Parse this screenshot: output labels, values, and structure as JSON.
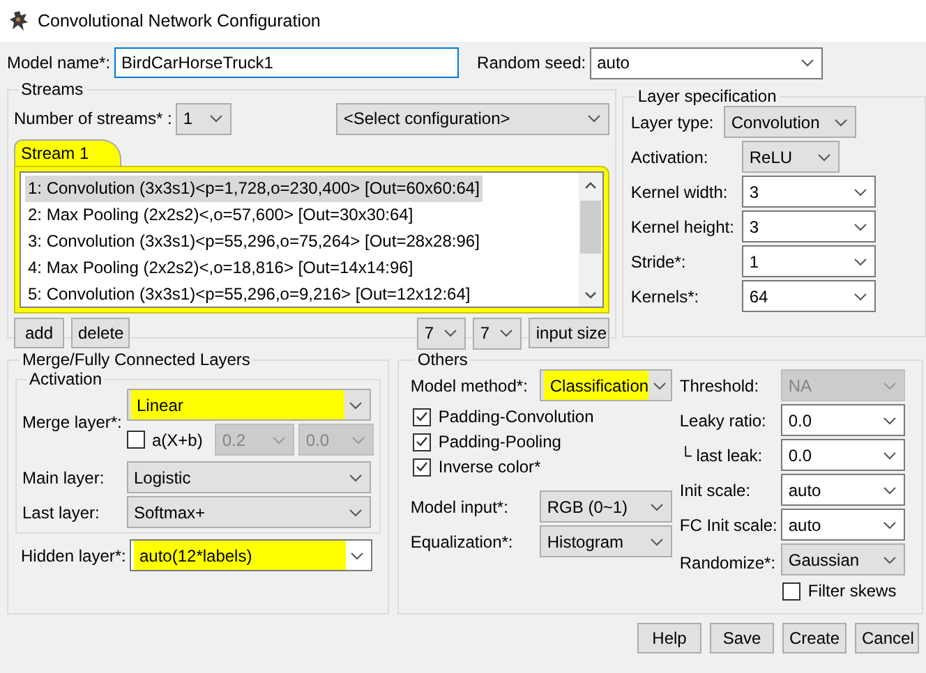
{
  "window": {
    "title": "Convolutional Network Configuration"
  },
  "model_name": {
    "label": "Model name*:",
    "value": "BirdCarHorseTruck1"
  },
  "random_seed": {
    "label": "Random seed:",
    "combo": {
      "kind": "edit",
      "value": "auto",
      "highlighted": false
    }
  },
  "streams": {
    "title": "Streams",
    "count_label": "Number of streams* :",
    "count": {
      "kind": "list",
      "value": "1",
      "highlighted": false
    },
    "configuration": {
      "kind": "list",
      "value": "<Select configuration>",
      "highlighted": false
    },
    "tabs": [
      {
        "label": "Stream 1",
        "selected": true
      }
    ],
    "layers": [
      {
        "text": "1: Convolution (3x3s1)<p=1,728,o=230,400> [Out=60x60:64]",
        "selected": true
      },
      {
        "text": "2: Max Pooling (2x2s2)<,o=57,600> [Out=30x30:64]",
        "selected": false
      },
      {
        "text": "3: Convolution (3x3s1)<p=55,296,o=75,264> [Out=28x28:96]",
        "selected": false
      },
      {
        "text": "4: Max Pooling (2x2s2)<,o=18,816> [Out=14x14:96]",
        "selected": false
      },
      {
        "text": "5: Convolution (3x3s1)<p=55,296,o=9,216> [Out=12x12:64]",
        "selected": false
      }
    ],
    "buttons": [
      "add",
      "delete"
    ],
    "size_a": {
      "kind": "list",
      "value": "7",
      "highlighted": false
    },
    "size_b": {
      "kind": "list",
      "value": "7",
      "highlighted": false
    },
    "input_size_button": "input size"
  },
  "layer_specification": {
    "title": "Layer specification",
    "fields": [
      {
        "label": "Layer type:",
        "combo": {
          "kind": "list",
          "value": "Convolution",
          "highlighted": false
        }
      },
      {
        "label": "Activation:",
        "combo": {
          "kind": "list",
          "value": "ReLU",
          "highlighted": false
        }
      },
      {
        "label": "Kernel width:",
        "combo": {
          "kind": "edit",
          "value": "3",
          "highlighted": false
        }
      },
      {
        "label": "Kernel height:",
        "combo": {
          "kind": "edit",
          "value": "3",
          "highlighted": false
        }
      },
      {
        "label": "Stride*:",
        "combo": {
          "kind": "edit",
          "value": "1",
          "highlighted": false
        }
      },
      {
        "label": "Kernels*:",
        "combo": {
          "kind": "edit",
          "value": "64",
          "highlighted": false
        }
      }
    ]
  },
  "merge": {
    "title": "Merge/Fully Connected Layers",
    "activation": {
      "title": "Activation",
      "merge_label": "Merge layer*:",
      "merge": {
        "kind": "list",
        "value": "Linear",
        "highlighted": true
      },
      "axb": {
        "label": "a(X+b)",
        "checked": false
      },
      "a": {
        "kind": "disabled",
        "value": "0.2",
        "highlighted": false
      },
      "b": {
        "kind": "disabled",
        "value": "0.0",
        "highlighted": false
      },
      "main_label": "Main layer:",
      "main": {
        "kind": "list",
        "value": "Logistic",
        "highlighted": false
      },
      "last_label": "Last layer:",
      "last": {
        "kind": "list",
        "value": "Softmax+",
        "highlighted": false
      }
    },
    "hidden_label": "Hidden layer*:",
    "hidden": {
      "kind": "edit",
      "value": "auto(12*labels)",
      "highlighted": true
    }
  },
  "others": {
    "title": "Others",
    "method_label": "Model method*:",
    "method": {
      "kind": "list",
      "value": "Classification",
      "highlighted": true
    },
    "checkboxes": [
      {
        "label": "Padding-Convolution",
        "checked": true
      },
      {
        "label": "Padding-Pooling",
        "checked": true
      },
      {
        "label": "Inverse color*",
        "checked": true
      }
    ],
    "input_label": "Model input*:",
    "input": {
      "kind": "list",
      "value": "RGB (0~1)",
      "highlighted": false
    },
    "equalization_label": "Equalization*:",
    "equalization": {
      "kind": "list",
      "value": "Histogram",
      "highlighted": false
    },
    "fields": [
      {
        "label": "Threshold:",
        "combo": {
          "kind": "disabled",
          "value": "NA",
          "highlighted": false
        }
      },
      {
        "label": "Leaky ratio:",
        "combo": {
          "kind": "edit",
          "value": "0.0",
          "highlighted": false
        }
      },
      {
        "label": "└ last leak:",
        "combo": {
          "kind": "edit",
          "value": "0.0",
          "highlighted": false
        }
      },
      {
        "label": "Init scale:",
        "combo": {
          "kind": "edit",
          "value": "auto",
          "highlighted": false
        }
      },
      {
        "label": "FC Init scale:",
        "combo": {
          "kind": "edit",
          "value": "auto",
          "highlighted": false
        }
      },
      {
        "label": "Randomize*:",
        "combo": {
          "kind": "list",
          "value": "Gaussian",
          "highlighted": false
        }
      }
    ],
    "filter_skews": {
      "label": "Filter skews",
      "checked": false
    }
  },
  "buttons": [
    "Help",
    "Save",
    "Create",
    "Cancel"
  ]
}
